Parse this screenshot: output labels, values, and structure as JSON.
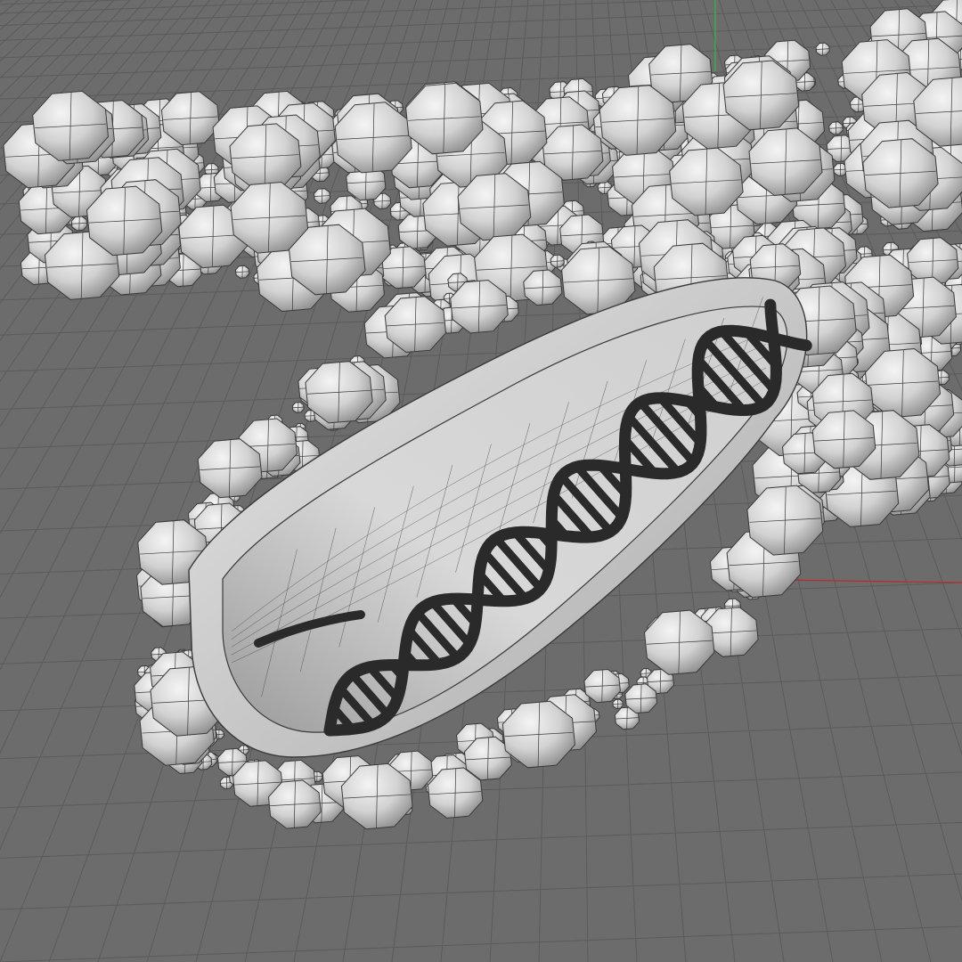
{
  "viewport": {
    "background_color": "#6c6c6c",
    "grid_line_color": "#5b5b5b",
    "x_axis_color": "#c0282a",
    "y_axis_color": "#2bbf3a"
  },
  "model": {
    "blob_fill": "#d9d9d9",
    "blob_edge": "#3a3a3a",
    "shell_fill": "#cfcfcf",
    "cavity_fill": "#bdbdbd",
    "helix_color": "#2a2a2a"
  }
}
